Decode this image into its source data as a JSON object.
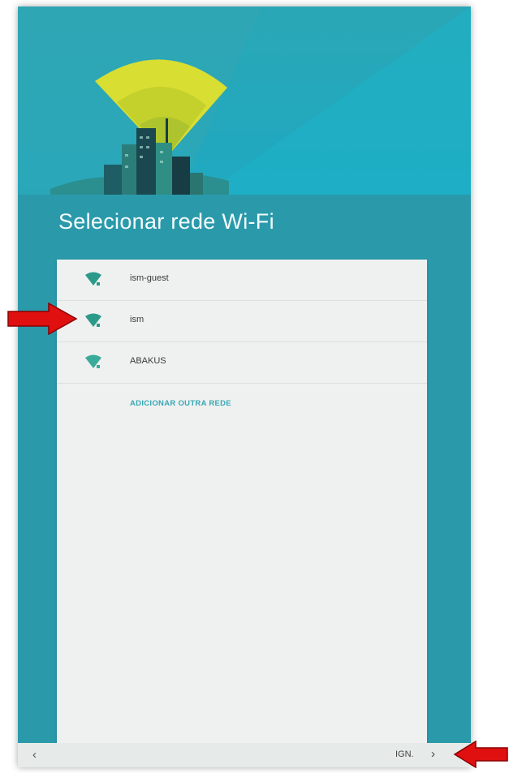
{
  "setup": {
    "title": "Selecionar rede Wi-Fi",
    "networks": [
      {
        "ssid": "ism-guest",
        "icon": "wifi-signal-icon"
      },
      {
        "ssid": "ism",
        "icon": "wifi-signal-icon"
      },
      {
        "ssid": "ABAKUS",
        "icon": "wifi-signal-icon"
      }
    ],
    "add_network_label": "ADICIONAR OUTRA REDE"
  },
  "nav": {
    "back_label": "‹",
    "skip_label": "IGN.",
    "next_label": "›"
  },
  "colors": {
    "background": "#2a9aab",
    "accent": "#3aa6b5",
    "wifi_icon": "#2b9a8a",
    "annotation_arrow": "#e01010"
  }
}
